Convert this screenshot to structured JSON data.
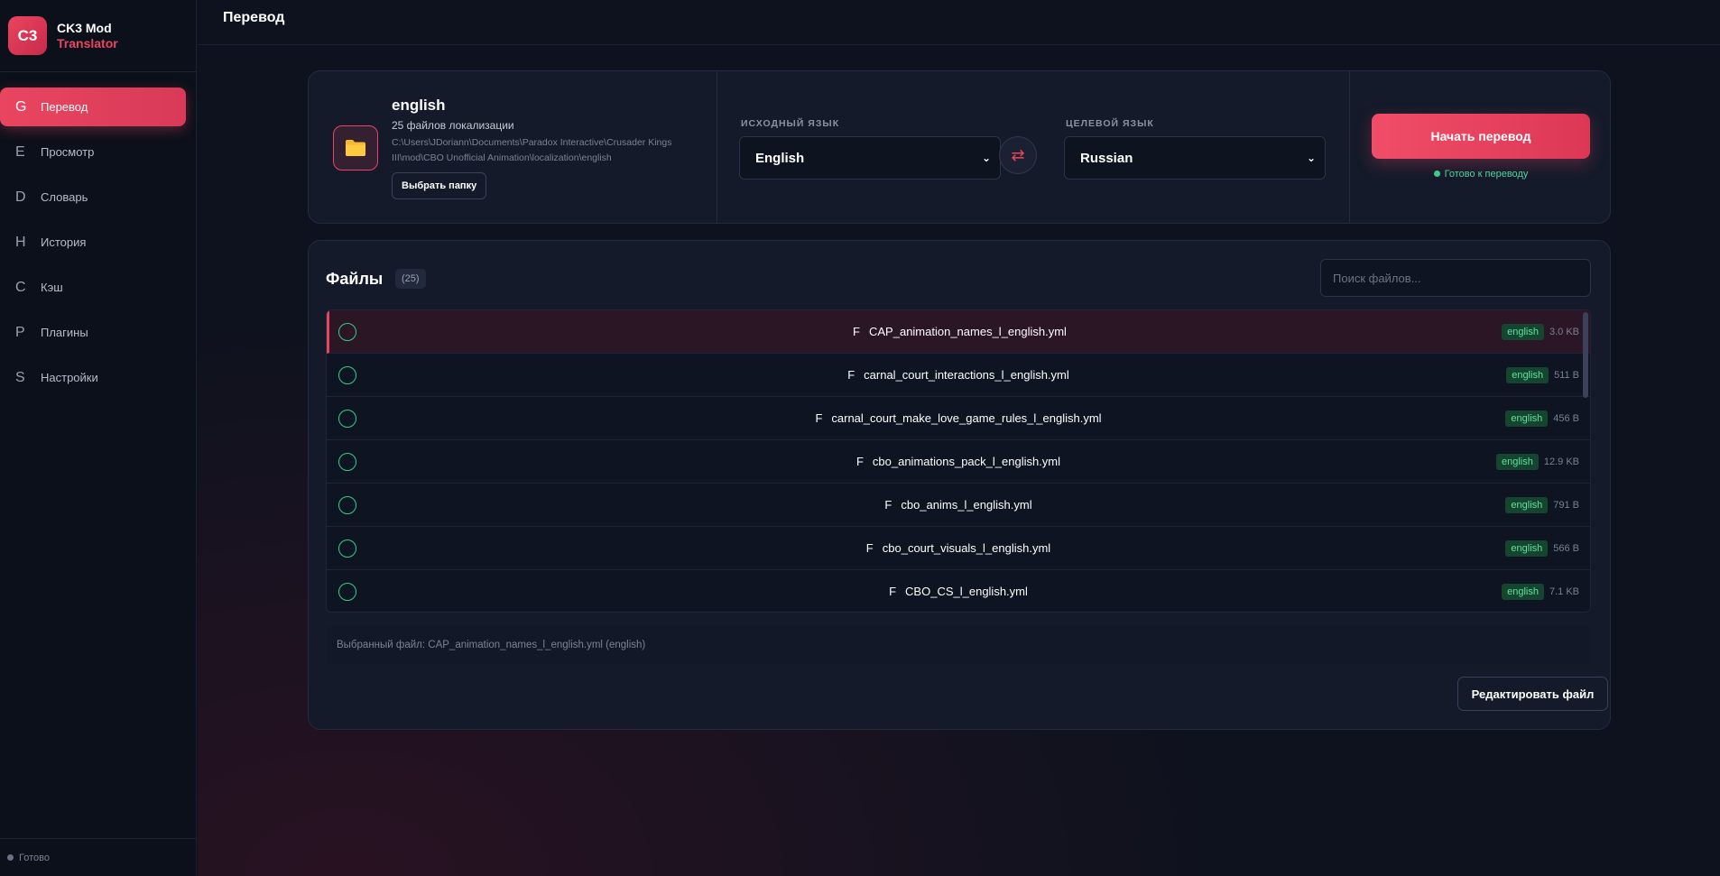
{
  "app": {
    "logo_text": "C3",
    "title": "CK3 Mod",
    "subtitle": "Translator"
  },
  "sidebar": {
    "items": [
      {
        "letter": "G",
        "label": "Перевод",
        "active": true
      },
      {
        "letter": "E",
        "label": "Просмотр"
      },
      {
        "letter": "D",
        "label": "Словарь"
      },
      {
        "letter": "H",
        "label": "История"
      },
      {
        "letter": "C",
        "label": "Кэш"
      },
      {
        "letter": "P",
        "label": "Плагины"
      },
      {
        "letter": "S",
        "label": "Настройки"
      }
    ],
    "status": "Готово"
  },
  "header": {
    "title": "Перевод"
  },
  "folder": {
    "name": "english",
    "count": "25 файлов локализации",
    "path": "C:\\Users\\JDoriann\\Documents\\Paradox Interactive\\Crusader Kings III\\mod\\CBO Unofficial Animation\\localization\\english",
    "choose_label": "Выбрать папку",
    "icon": "folder-icon"
  },
  "languages": {
    "source_label": "ИСХОДНЫЙ ЯЗЫК",
    "source_value": "English",
    "target_label": "ЦЕЛЕВОЙ ЯЗЫК",
    "target_value": "Russian",
    "swap_glyph": "⇄"
  },
  "start": {
    "label": "Начать перевод",
    "status": "Готово к переводу"
  },
  "files": {
    "title": "Файлы",
    "count": "(25)",
    "search_placeholder": "Поиск файлов...",
    "rows": [
      {
        "type": "F",
        "name": "CAP_animation_names_l_english.yml",
        "lang": "english",
        "size": "3.0 KB",
        "selected": true
      },
      {
        "type": "F",
        "name": "carnal_court_interactions_l_english.yml",
        "lang": "english",
        "size": "511 B"
      },
      {
        "type": "F",
        "name": "carnal_court_make_love_game_rules_l_english.yml",
        "lang": "english",
        "size": "456 B"
      },
      {
        "type": "F",
        "name": "cbo_animations_pack_l_english.yml",
        "lang": "english",
        "size": "12.9 KB"
      },
      {
        "type": "F",
        "name": "cbo_anims_l_english.yml",
        "lang": "english",
        "size": "791 B"
      },
      {
        "type": "F",
        "name": "cbo_court_visuals_l_english.yml",
        "lang": "english",
        "size": "566 B"
      },
      {
        "type": "F",
        "name": "CBO_CS_l_english.yml",
        "lang": "english",
        "size": "7.1 KB"
      }
    ],
    "selected_info": "Выбранный файл: CAP_animation_names_l_english.yml (english)",
    "edit_label": "Редактировать файл"
  },
  "colors": {
    "accent": "#e94560",
    "success": "#3ccb8a",
    "background": "#0e121e"
  }
}
